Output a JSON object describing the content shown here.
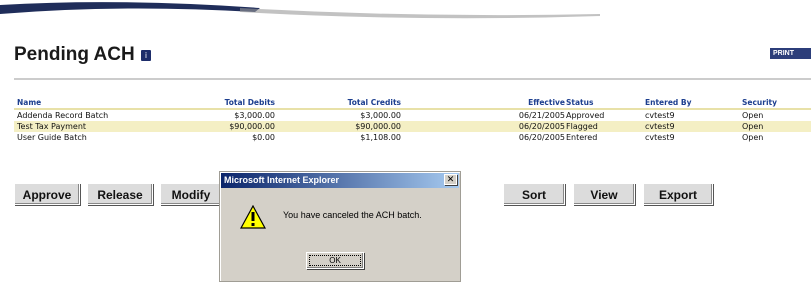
{
  "page": {
    "title": "Pending ACH",
    "title_icon": "info-icon",
    "print_label": "PRINT"
  },
  "table": {
    "headers": {
      "name": "Name",
      "total_debits": "Total Debits",
      "total_credits": "Total Credits",
      "effective": "Effective",
      "status": "Status",
      "entered_by": "Entered By",
      "security": "Security"
    },
    "rows": [
      {
        "name": "Addenda Record Batch",
        "total_debits": "$3,000.00",
        "total_credits": "$3,000.00",
        "effective": "06/21/2005",
        "status": "Approved",
        "entered_by": "cvtest9",
        "security": "Open"
      },
      {
        "name": "Test Tax Payment",
        "total_debits": "$90,000.00",
        "total_credits": "$90,000.00",
        "effective": "06/20/2005",
        "status": "Flagged",
        "entered_by": "cvtest9",
        "security": "Open"
      },
      {
        "name": "User Guide Batch",
        "total_debits": "$0.00",
        "total_credits": "$1,108.00",
        "effective": "06/20/2005",
        "status": "Entered",
        "entered_by": "cvtest9",
        "security": "Open"
      }
    ],
    "alt_row_color": "#f4efc4",
    "header_color": "#1d3f8f"
  },
  "buttons": {
    "approve": "Approve",
    "release": "Release",
    "modify": "Modify",
    "sort": "Sort",
    "view": "View",
    "export": "Export"
  },
  "dialog": {
    "title": "Microsoft Internet Explorer",
    "close_glyph": "✕",
    "icon": "warning-icon",
    "message": "You have canceled the ACH batch.",
    "ok_label": "OK"
  }
}
